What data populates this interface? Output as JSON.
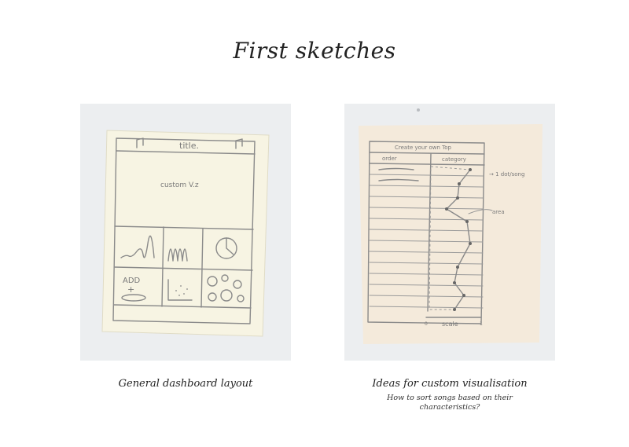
{
  "title": "First sketches",
  "sketches": [
    {
      "caption": "General dashboard layout",
      "sketch_text": {
        "header_title": "title.",
        "main_panel": "custom V.z",
        "add_label": "ADD"
      }
    },
    {
      "caption": "Ideas for custom visualisation",
      "subcaption": "How to sort songs based on their characteristics?",
      "sketch_text": {
        "header_title": "Create your own Top",
        "col_order": "order",
        "col_category": "category",
        "note_dots": "→ 1 dot/song",
        "note_area": "area",
        "scale_label": "scale",
        "scale_min": "0",
        "scale_max": "1"
      }
    }
  ],
  "colors": {
    "left_paper": "#f7f4e3",
    "right_paper": "#f4eadb",
    "photo_bg": "#eceef0",
    "pencil": "#8a8a8a"
  }
}
